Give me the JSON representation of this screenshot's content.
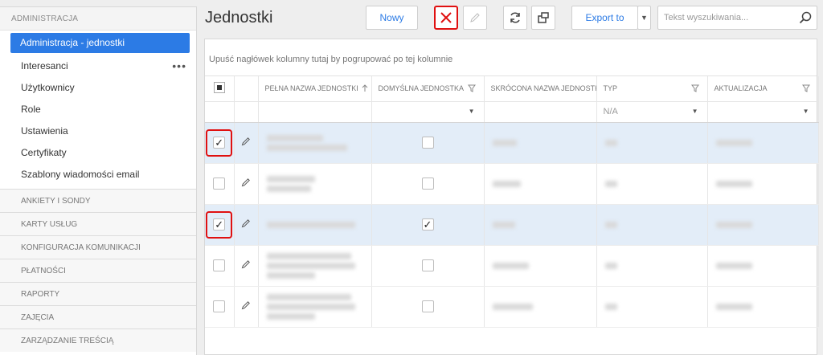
{
  "sidebar": {
    "header": "ADMINISTRACJA",
    "items": [
      {
        "label": "Administracja - jednostki",
        "active": true
      },
      {
        "label": "Interesanci",
        "more": "•••"
      },
      {
        "label": "Użytkownicy"
      },
      {
        "label": "Role"
      },
      {
        "label": "Ustawienia"
      },
      {
        "label": "Certyfikaty"
      },
      {
        "label": "Szablony wiadomości email"
      }
    ],
    "sections": [
      "ANKIETY I SONDY",
      "KARTY USŁUG",
      "KONFIGURACJA KOMUNIKACJI",
      "PŁATNOŚCI",
      "RAPORTY",
      "ZAJĘCIA",
      "ZARZĄDZANIE TREŚCIĄ"
    ]
  },
  "page": {
    "title": "Jednostki"
  },
  "toolbar": {
    "new_label": "Nowy",
    "export_label": "Export to",
    "accent_color": "#2c7be5",
    "highlight_color": "#e01010"
  },
  "search": {
    "placeholder": "Tekst wyszukiwania..."
  },
  "grid": {
    "group_panel_text": "Upuść nagłówek kolumny tutaj by pogrupować po tej kolumnie",
    "columns": [
      "PEŁNA NAZWA JEDNOSTKI",
      "DOMYŚLNA JEDNOSTKA",
      "SKRÓCONA NAZWA JEDNOSTKI",
      "TYP",
      "AKTUALIZACJA"
    ],
    "filters": {
      "typ": "N/A"
    },
    "rows": [
      {
        "selected": true,
        "checked": true,
        "default": false
      },
      {
        "selected": false,
        "checked": false,
        "default": false
      },
      {
        "selected": true,
        "checked": true,
        "default": true
      },
      {
        "selected": false,
        "checked": false,
        "default": false
      },
      {
        "selected": false,
        "checked": false,
        "default": false
      }
    ],
    "checkmark": "✓"
  }
}
